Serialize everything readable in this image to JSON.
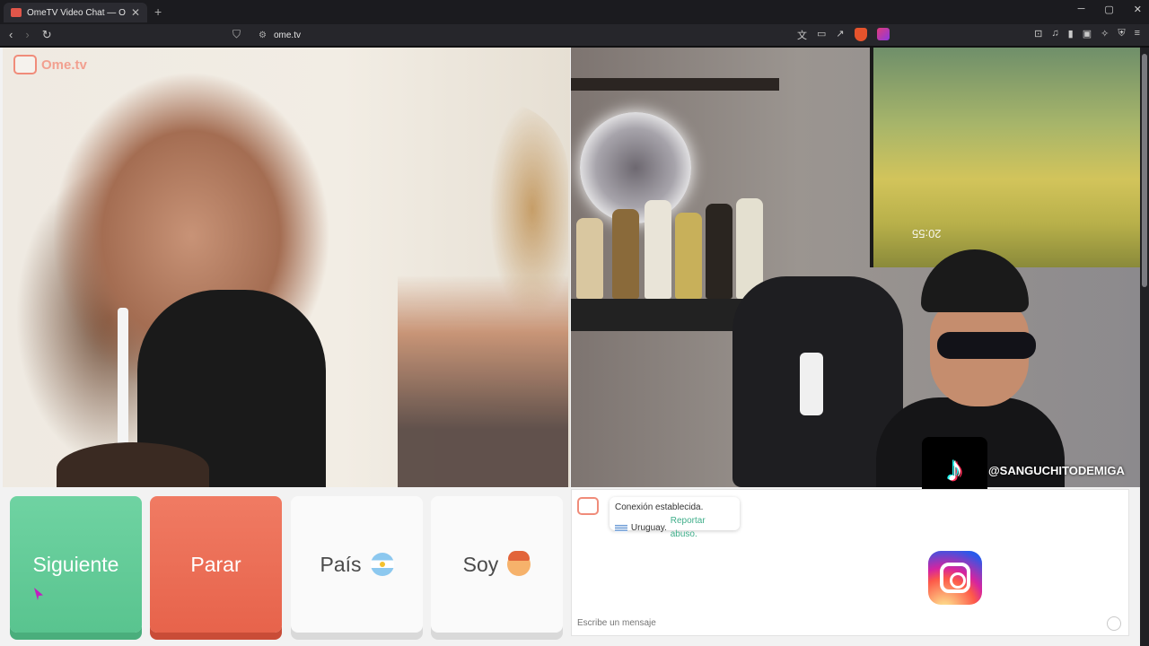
{
  "browser": {
    "tab_title": "OmeTV Video Chat — Omegle",
    "new_tab": "+",
    "url": "ome.tv",
    "window_controls": [
      "─",
      "▢",
      "✕"
    ]
  },
  "left_video": {
    "logo_text": "Ome.tv"
  },
  "right_video": {
    "clock_text": "20:55",
    "tiktok_handle": "@SANGUCHITODEMIGA"
  },
  "buttons": {
    "next": "Siguiente",
    "stop": "Parar",
    "country": "País",
    "gender": "Soy"
  },
  "chat": {
    "status": "Conexión establecida.",
    "country": "Uruguay.",
    "report": "Reportar abuso.",
    "placeholder": "Escribe un mensaje"
  },
  "icons": {
    "back": "arrow-left-icon",
    "forward": "arrow-right-icon",
    "reload": "reload-icon",
    "bookmark": "bookmark-icon",
    "site_info": "site-info-icon"
  }
}
